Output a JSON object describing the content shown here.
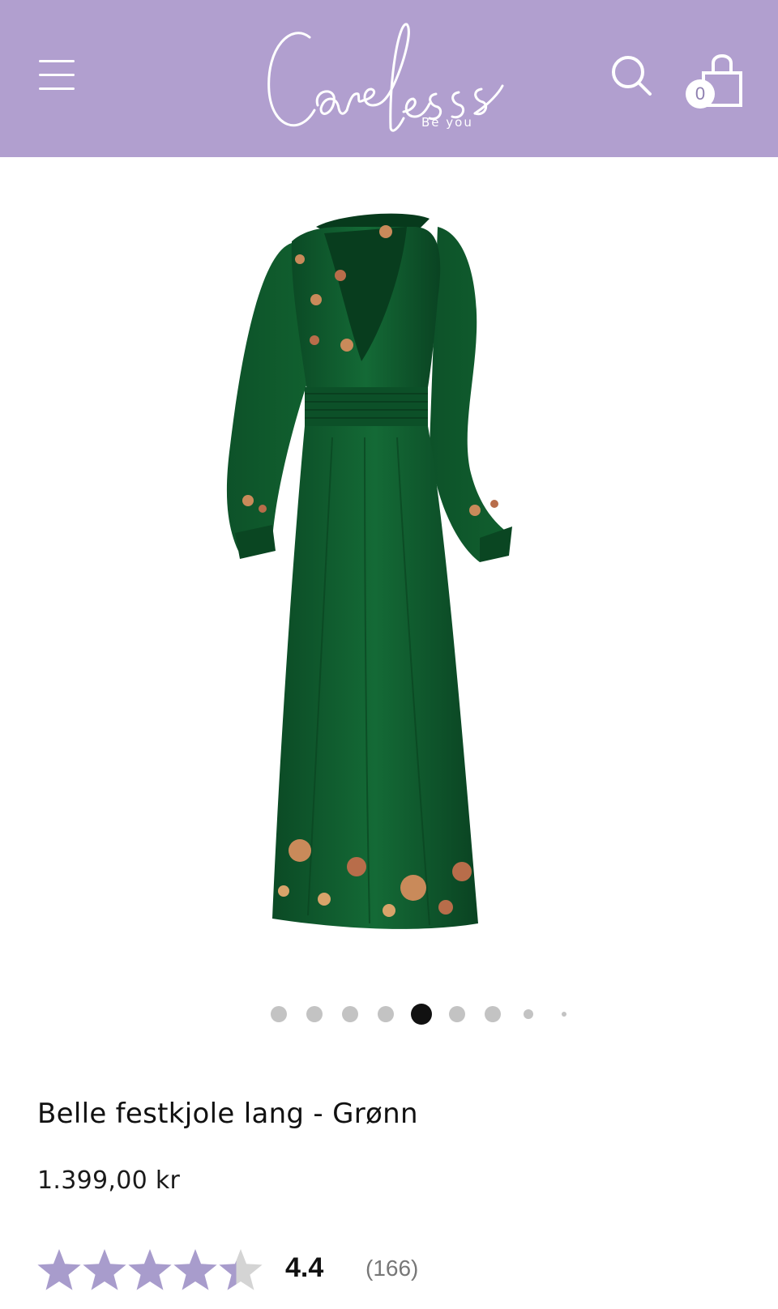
{
  "header": {
    "background_color": "#b19fcf",
    "logo": {
      "brand": "Careless",
      "tagline": "Be you"
    },
    "menu_icon": "hamburger-menu-icon",
    "search_icon": "search-icon",
    "cart": {
      "icon": "shopping-bag-icon",
      "count": "0"
    }
  },
  "product": {
    "image": "green-long-dress-with-floral-embroidery",
    "dress_color": "#0f5a2e",
    "gallery": {
      "total": 9,
      "active_index": 5
    },
    "title": "Belle festkjole lang - Grønn",
    "price": "1.399,00 kr",
    "rating": {
      "value": "4.4",
      "count": "(166)",
      "stars_filled": 4.4,
      "stars_total": 5,
      "star_color": "#a89ccc",
      "star_empty_color": "#d4d4d4"
    }
  }
}
